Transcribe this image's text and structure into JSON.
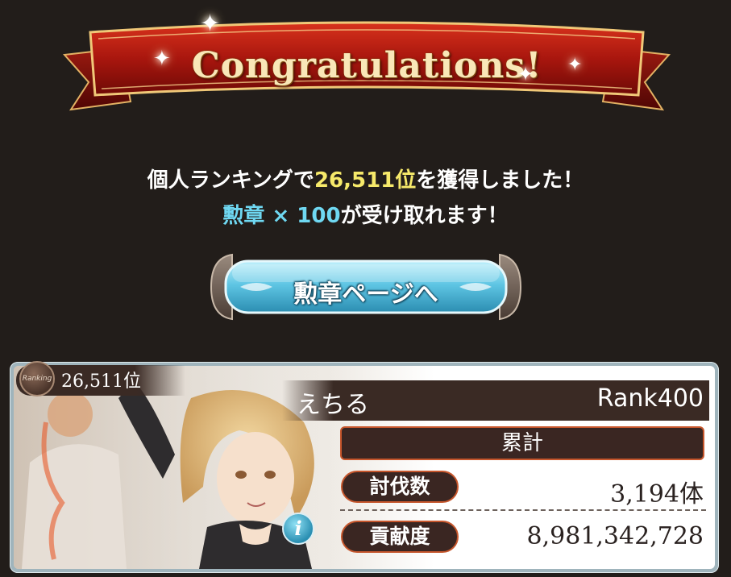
{
  "banner": {
    "title": "Congratulations!"
  },
  "message": {
    "line1_prefix": "個人ランキングで",
    "line1_rank": "26,511位",
    "line1_suffix": "を獲得しました！",
    "line2_reward": "勲章 × 100",
    "line2_suffix": "が受け取れます！"
  },
  "medal_button": {
    "label": "勲章ページへ"
  },
  "ranking_card": {
    "ranking_badge": "Ranking",
    "rank_position": "26,511位",
    "player_name": "えちる",
    "player_rank": "Rank400",
    "section_title": "累計",
    "stats": [
      {
        "label": "討伐数",
        "value": "3,194体"
      },
      {
        "label": "貢献度",
        "value": "8,981,342,728"
      }
    ],
    "info_icon": "info-icon"
  },
  "colors": {
    "background": "#221d1a",
    "highlight_yellow": "#f6e96a",
    "highlight_cyan": "#6fd8f2",
    "label_border": "#c6562c",
    "label_fill": "#3a2622"
  }
}
